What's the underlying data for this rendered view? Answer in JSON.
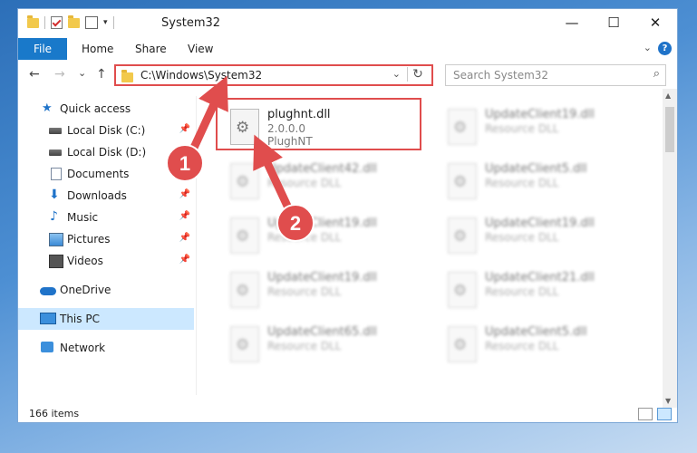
{
  "window": {
    "title": "System32",
    "minimize_glyph": "—",
    "maximize_glyph": "☐",
    "close_glyph": "✕"
  },
  "ribbon": {
    "tabs": [
      "File",
      "Home",
      "Share",
      "View"
    ],
    "help": "?",
    "collapse_glyph": "⌄"
  },
  "address": {
    "back": "←",
    "forward": "→",
    "recent": "⌄",
    "up": "↑",
    "path": "C:\\Windows\\System32",
    "dropdown": "⌄",
    "refresh": "↻",
    "search_placeholder": "Search System32",
    "search_glyph": "⌕"
  },
  "sidebar": {
    "items": [
      {
        "label": "Quick access",
        "icon": "star-icon"
      },
      {
        "label": "Local Disk (C:)",
        "icon": "drive-icon",
        "pinned": true
      },
      {
        "label": "Local Disk (D:)",
        "icon": "drive-icon",
        "pinned": false
      },
      {
        "label": "Documents",
        "icon": "documents-icon",
        "pinned": true
      },
      {
        "label": "Downloads",
        "icon": "download-icon",
        "pinned": true
      },
      {
        "label": "Music",
        "icon": "music-icon",
        "pinned": true
      },
      {
        "label": "Pictures",
        "icon": "pictures-icon",
        "pinned": true
      },
      {
        "label": "Videos",
        "icon": "videos-icon",
        "pinned": true
      },
      {
        "label": "OneDrive",
        "icon": "onedrive-icon"
      },
      {
        "label": "This PC",
        "icon": "this-pc-icon"
      },
      {
        "label": "Network",
        "icon": "network-icon"
      }
    ],
    "pin_glyph": "📌"
  },
  "files": [
    {
      "name": "plughnt.dll",
      "version": "2.0.0.0",
      "desc": "PlughNT"
    },
    {
      "name": "UpdateClient19.dll",
      "version": "",
      "desc": "Resource DLL"
    },
    {
      "name": "UpdateClient42.dll",
      "version": "",
      "desc": "Resource DLL"
    },
    {
      "name": "UpdateClient5.dll",
      "version": "",
      "desc": "Resource DLL"
    },
    {
      "name": "UpdateClient19.dll",
      "version": "",
      "desc": "Resource DLL"
    },
    {
      "name": "UpdateClient19.dll",
      "version": "",
      "desc": "Resource DLL"
    },
    {
      "name": "UpdateClient19.dll",
      "version": "",
      "desc": "Resource DLL"
    },
    {
      "name": "UpdateClient21.dll",
      "version": "",
      "desc": "Resource DLL"
    },
    {
      "name": "UpdateClient65.dll",
      "version": "",
      "desc": "Resource DLL"
    },
    {
      "name": "UpdateClient5.dll",
      "version": "",
      "desc": "Resource DLL"
    }
  ],
  "status": {
    "count": "166 items"
  },
  "annotations": {
    "badge1": "1",
    "badge2": "2"
  },
  "colors": {
    "accent": "#1979ca",
    "annotation_red": "#e04d4d"
  }
}
